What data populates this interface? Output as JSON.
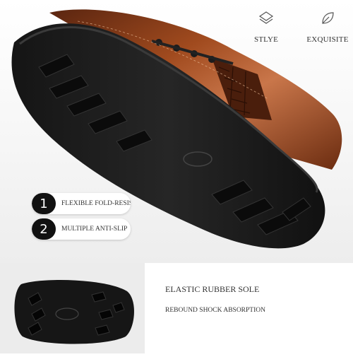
{
  "features": [
    {
      "icon": "layers-icon",
      "label": "STLYE"
    },
    {
      "icon": "leaf-icon",
      "label": "EXQUISITE"
    }
  ],
  "pills": [
    {
      "number": "1",
      "text": "FLEXIBLE FOLD-RESISTANT"
    },
    {
      "number": "2",
      "text": "MULTIPLE ANTI-SLIP"
    }
  ],
  "bottom": {
    "title": "ELASTIC RUBBER SOLE",
    "subtitle": "REBOUND SHOCK ABSORPTION"
  },
  "colors": {
    "leather": "#8a3f1a",
    "sole": "#1b1b1b",
    "accent_dark": "#111111"
  }
}
